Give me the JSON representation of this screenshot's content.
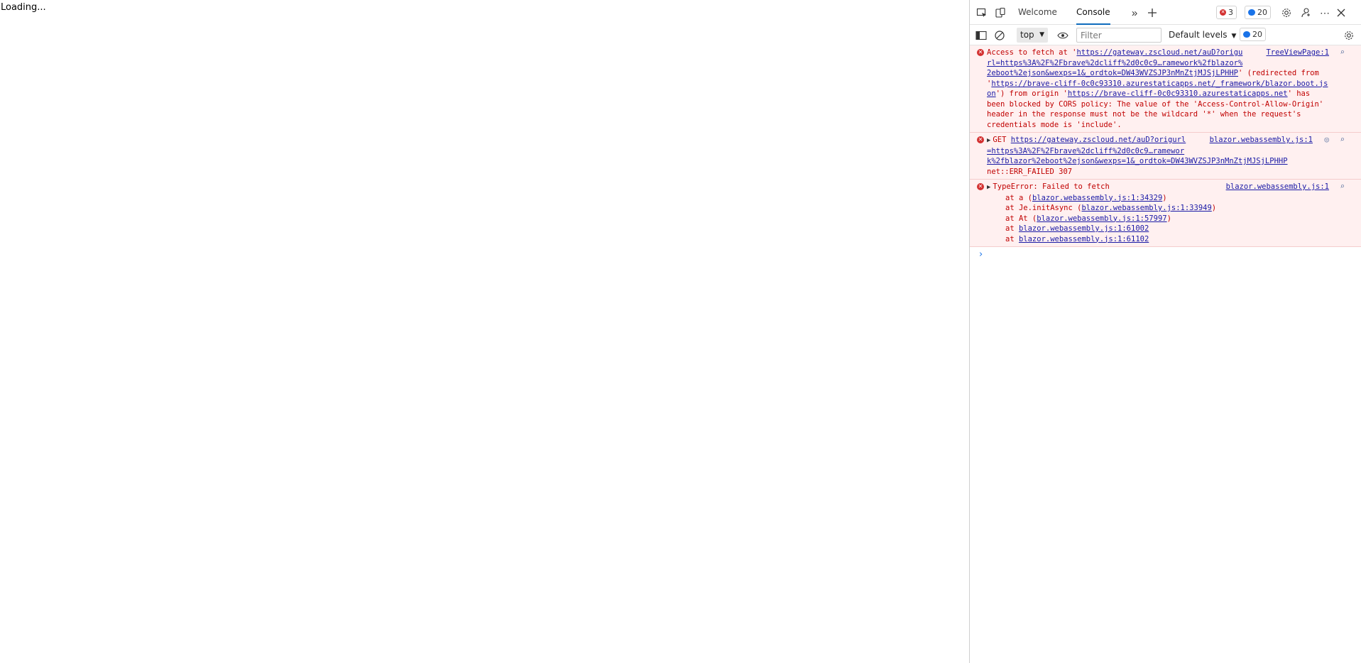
{
  "page": {
    "loading_text": "Loading..."
  },
  "devtools": {
    "tabs": [
      {
        "label": "Welcome"
      },
      {
        "label": "Console"
      }
    ],
    "error_count": "3",
    "message_count": "20",
    "toolbar": {
      "context": "top",
      "filter_placeholder": "Filter",
      "levels": "Default levels",
      "info_count": "20"
    },
    "messages": [
      {
        "type": "error",
        "source": "TreeViewPage:1",
        "lines": [
          "Access to fetch at '",
          "https://gateway.zscloud.net/auD?origu",
          "rl=https%3A%2F%2Fbrave%2dcliff%2d0c0c9…ramework%2fblazor%",
          "2eboot%2ejson&wexps=1&_ordtok=DW43WVZSJP3nMnZtjMJSjLPHHP",
          "' (redirected from",
          "'",
          "https://brave-cliff-0c0c93310.azurestaticapps.net/_framework/blazor.boot.js",
          "on",
          "') from origin '",
          "https://brave-cliff-0c0c93310.azurestaticapps.net",
          "' has",
          "been blocked by CORS policy: The value of the 'Access-Control-Allow-Origin'",
          "header in the response must not be the wildcard '*' when the request's",
          "credentials mode is 'include'."
        ]
      },
      {
        "type": "error",
        "source": "blazor.webassembly.js:1",
        "method": "GET",
        "lines": [
          "https://gateway.zscloud.net/auD?origurl",
          "=https%3A%2F%2Fbrave%2dcliff%2d0c0c9…ramewor",
          "k%2fblazor%2eboot%2ejson&wexps=1&_ordtok=DW43WVZSJP3nMnZtjMJSjLPHHP",
          "net::ERR_FAILED 307"
        ]
      },
      {
        "type": "error",
        "source": "blazor.webassembly.js:1",
        "title": "TypeError: Failed to fetch",
        "stack": [
          {
            "prefix": "at a (",
            "link": "blazor.webassembly.js:1:34329",
            "suffix": ")"
          },
          {
            "prefix": "at Je.initAsync (",
            "link": "blazor.webassembly.js:1:33949",
            "suffix": ")"
          },
          {
            "prefix": "at At (",
            "link": "blazor.webassembly.js:1:57997",
            "suffix": ")"
          },
          {
            "prefix": "at ",
            "link": "blazor.webassembly.js:1:61002",
            "suffix": ""
          },
          {
            "prefix": "at ",
            "link": "blazor.webassembly.js:1:61102",
            "suffix": ""
          }
        ]
      }
    ],
    "prompt_symbol": "›"
  }
}
